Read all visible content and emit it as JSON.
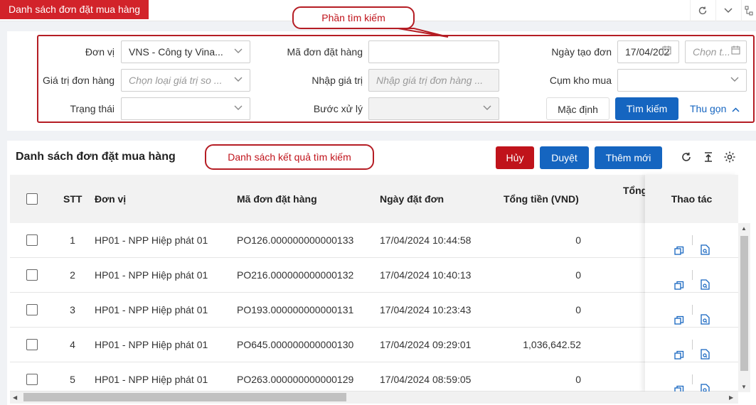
{
  "window": {
    "tab_title": "Danh sách đơn đặt mua hàng"
  },
  "callouts": {
    "search": "Phần tìm kiếm",
    "results": "Danh sách kết quả tìm kiếm"
  },
  "search": {
    "don_vi": {
      "label": "Đơn vị",
      "value": "VNS - Công ty Vina..."
    },
    "ma_don": {
      "label": "Mã đơn đặt hàng",
      "value": ""
    },
    "ngay_tao": {
      "label": "Ngày tạo đơn",
      "from_value": "17/04/202",
      "to_placeholder": "Chọn t..."
    },
    "gia_tri": {
      "label": "Giá trị đơn hàng",
      "placeholder": "Chọn loại giá trị so ..."
    },
    "nhap_gia_tri": {
      "label": "Nhập giá trị",
      "placeholder": "Nhập giá trị đơn hàng ..."
    },
    "cum_kho": {
      "label": "Cụm kho mua",
      "value": ""
    },
    "trang_thai": {
      "label": "Trạng thái",
      "value": ""
    },
    "buoc_xu_ly": {
      "label": "Bước xử lý",
      "value": ""
    },
    "buttons": {
      "default": "Mặc định",
      "search": "Tìm kiếm",
      "collapse": "Thu gọn"
    }
  },
  "results": {
    "title": "Danh sách đơn đặt mua hàng",
    "buttons": {
      "cancel": "Hủy",
      "approve": "Duyệt",
      "add": "Thêm mới"
    },
    "columns": {
      "stt": "STT",
      "don_vi": "Đơn vị",
      "ma_don": "Mã đơn đặt hàng",
      "ngay_dat": "Ngày đặt đơn",
      "tong_tien": "Tổng tiền (VND)",
      "tong_cut": "Tổng",
      "thao_tac": "Thao tác"
    },
    "rows": [
      {
        "stt": "1",
        "don_vi": "HP01 - NPP Hiệp phát 01",
        "ma_don": "PO126.000000000000133",
        "ngay_dat": "17/04/2024 10:44:58",
        "tong_tien": "0"
      },
      {
        "stt": "2",
        "don_vi": "HP01 - NPP Hiệp phát 01",
        "ma_don": "PO216.000000000000132",
        "ngay_dat": "17/04/2024 10:40:13",
        "tong_tien": "0"
      },
      {
        "stt": "3",
        "don_vi": "HP01 - NPP Hiệp phát 01",
        "ma_don": "PO193.000000000000131",
        "ngay_dat": "17/04/2024 10:23:43",
        "tong_tien": "0"
      },
      {
        "stt": "4",
        "don_vi": "HP01 - NPP Hiệp phát 01",
        "ma_don": "PO645.000000000000130",
        "ngay_dat": "17/04/2024 09:29:01",
        "tong_tien": "1,036,642.52"
      },
      {
        "stt": "5",
        "don_vi": "HP01 - NPP Hiệp phát 01",
        "ma_don": "PO263.000000000000129",
        "ngay_dat": "17/04/2024 08:59:05",
        "tong_tien": "0"
      }
    ]
  },
  "colors": {
    "brand_red": "#d2232a",
    "primary_blue": "#1565c0",
    "callout_red": "#b51d24"
  }
}
